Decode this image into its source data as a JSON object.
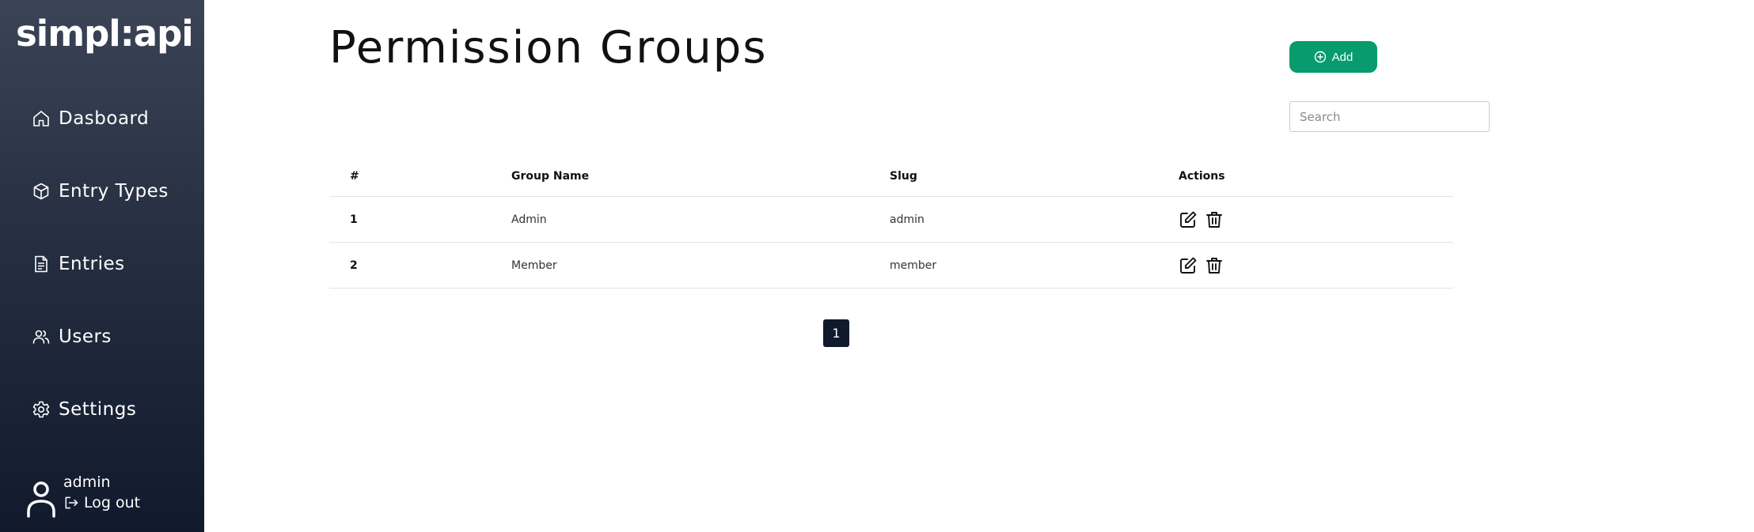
{
  "sidebar": {
    "logo": "simpl:api",
    "items": [
      {
        "label": "Dasboard",
        "icon": "home-icon"
      },
      {
        "label": "Entry Types",
        "icon": "cube-icon"
      },
      {
        "label": "Entries",
        "icon": "document-icon"
      },
      {
        "label": "Users",
        "icon": "users-icon"
      },
      {
        "label": "Settings",
        "icon": "gear-icon"
      }
    ],
    "user": {
      "name": "admin",
      "logout_label": "Log out"
    }
  },
  "header": {
    "title": "Permission Groups",
    "add_label": "Add"
  },
  "search": {
    "placeholder": "Search",
    "value": ""
  },
  "table": {
    "columns": [
      "#",
      "Group Name",
      "Slug",
      "Actions"
    ],
    "rows": [
      {
        "id": "1",
        "name": "Admin",
        "slug": "admin"
      },
      {
        "id": "2",
        "name": "Member",
        "slug": "member"
      }
    ]
  },
  "pagination": {
    "current": "1"
  },
  "colors": {
    "accent": "#089b6d",
    "sidebar_dark": "#111a2c",
    "sidebar_light": "#3b4456"
  }
}
